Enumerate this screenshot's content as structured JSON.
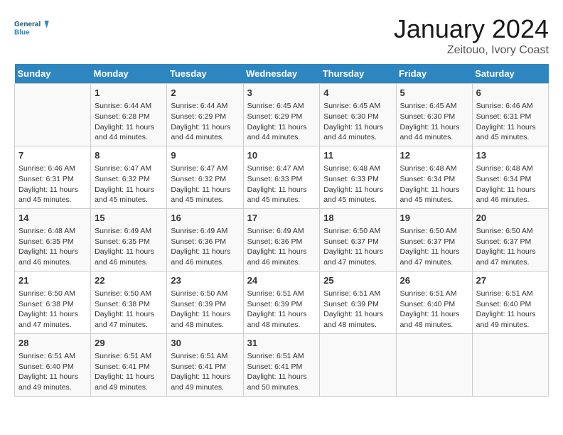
{
  "header": {
    "logo_line1": "General",
    "logo_line2": "Blue",
    "month": "January 2024",
    "location": "Zeitouo, Ivory Coast"
  },
  "days_of_week": [
    "Sunday",
    "Monday",
    "Tuesday",
    "Wednesday",
    "Thursday",
    "Friday",
    "Saturday"
  ],
  "weeks": [
    [
      {
        "num": "",
        "info": ""
      },
      {
        "num": "1",
        "info": "Sunrise: 6:44 AM\nSunset: 6:28 PM\nDaylight: 11 hours and 44 minutes."
      },
      {
        "num": "2",
        "info": "Sunrise: 6:44 AM\nSunset: 6:29 PM\nDaylight: 11 hours and 44 minutes."
      },
      {
        "num": "3",
        "info": "Sunrise: 6:45 AM\nSunset: 6:29 PM\nDaylight: 11 hours and 44 minutes."
      },
      {
        "num": "4",
        "info": "Sunrise: 6:45 AM\nSunset: 6:30 PM\nDaylight: 11 hours and 44 minutes."
      },
      {
        "num": "5",
        "info": "Sunrise: 6:45 AM\nSunset: 6:30 PM\nDaylight: 11 hours and 44 minutes."
      },
      {
        "num": "6",
        "info": "Sunrise: 6:46 AM\nSunset: 6:31 PM\nDaylight: 11 hours and 45 minutes."
      }
    ],
    [
      {
        "num": "7",
        "info": "Sunrise: 6:46 AM\nSunset: 6:31 PM\nDaylight: 11 hours and 45 minutes."
      },
      {
        "num": "8",
        "info": "Sunrise: 6:47 AM\nSunset: 6:32 PM\nDaylight: 11 hours and 45 minutes."
      },
      {
        "num": "9",
        "info": "Sunrise: 6:47 AM\nSunset: 6:32 PM\nDaylight: 11 hours and 45 minutes."
      },
      {
        "num": "10",
        "info": "Sunrise: 6:47 AM\nSunset: 6:33 PM\nDaylight: 11 hours and 45 minutes."
      },
      {
        "num": "11",
        "info": "Sunrise: 6:48 AM\nSunset: 6:33 PM\nDaylight: 11 hours and 45 minutes."
      },
      {
        "num": "12",
        "info": "Sunrise: 6:48 AM\nSunset: 6:34 PM\nDaylight: 11 hours and 45 minutes."
      },
      {
        "num": "13",
        "info": "Sunrise: 6:48 AM\nSunset: 6:34 PM\nDaylight: 11 hours and 46 minutes."
      }
    ],
    [
      {
        "num": "14",
        "info": "Sunrise: 6:48 AM\nSunset: 6:35 PM\nDaylight: 11 hours and 46 minutes."
      },
      {
        "num": "15",
        "info": "Sunrise: 6:49 AM\nSunset: 6:35 PM\nDaylight: 11 hours and 46 minutes."
      },
      {
        "num": "16",
        "info": "Sunrise: 6:49 AM\nSunset: 6:36 PM\nDaylight: 11 hours and 46 minutes."
      },
      {
        "num": "17",
        "info": "Sunrise: 6:49 AM\nSunset: 6:36 PM\nDaylight: 11 hours and 46 minutes."
      },
      {
        "num": "18",
        "info": "Sunrise: 6:50 AM\nSunset: 6:37 PM\nDaylight: 11 hours and 47 minutes."
      },
      {
        "num": "19",
        "info": "Sunrise: 6:50 AM\nSunset: 6:37 PM\nDaylight: 11 hours and 47 minutes."
      },
      {
        "num": "20",
        "info": "Sunrise: 6:50 AM\nSunset: 6:37 PM\nDaylight: 11 hours and 47 minutes."
      }
    ],
    [
      {
        "num": "21",
        "info": "Sunrise: 6:50 AM\nSunset: 6:38 PM\nDaylight: 11 hours and 47 minutes."
      },
      {
        "num": "22",
        "info": "Sunrise: 6:50 AM\nSunset: 6:38 PM\nDaylight: 11 hours and 47 minutes."
      },
      {
        "num": "23",
        "info": "Sunrise: 6:50 AM\nSunset: 6:39 PM\nDaylight: 11 hours and 48 minutes."
      },
      {
        "num": "24",
        "info": "Sunrise: 6:51 AM\nSunset: 6:39 PM\nDaylight: 11 hours and 48 minutes."
      },
      {
        "num": "25",
        "info": "Sunrise: 6:51 AM\nSunset: 6:39 PM\nDaylight: 11 hours and 48 minutes."
      },
      {
        "num": "26",
        "info": "Sunrise: 6:51 AM\nSunset: 6:40 PM\nDaylight: 11 hours and 48 minutes."
      },
      {
        "num": "27",
        "info": "Sunrise: 6:51 AM\nSunset: 6:40 PM\nDaylight: 11 hours and 49 minutes."
      }
    ],
    [
      {
        "num": "28",
        "info": "Sunrise: 6:51 AM\nSunset: 6:40 PM\nDaylight: 11 hours and 49 minutes."
      },
      {
        "num": "29",
        "info": "Sunrise: 6:51 AM\nSunset: 6:41 PM\nDaylight: 11 hours and 49 minutes."
      },
      {
        "num": "30",
        "info": "Sunrise: 6:51 AM\nSunset: 6:41 PM\nDaylight: 11 hours and 49 minutes."
      },
      {
        "num": "31",
        "info": "Sunrise: 6:51 AM\nSunset: 6:41 PM\nDaylight: 11 hours and 50 minutes."
      },
      {
        "num": "",
        "info": ""
      },
      {
        "num": "",
        "info": ""
      },
      {
        "num": "",
        "info": ""
      }
    ]
  ]
}
